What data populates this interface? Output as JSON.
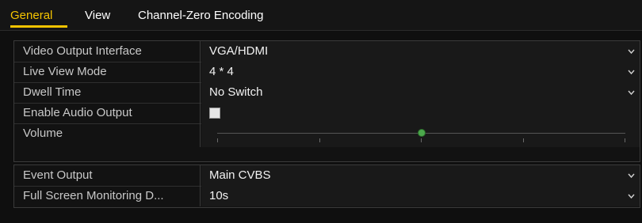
{
  "tabs": [
    {
      "label": "General",
      "active": true
    },
    {
      "label": "View",
      "active": false
    },
    {
      "label": "Channel-Zero Encoding",
      "active": false
    }
  ],
  "settings": {
    "video_output_interface": {
      "label": "Video Output Interface",
      "value": "VGA/HDMI"
    },
    "live_view_mode": {
      "label": "Live View Mode",
      "value": "4 * 4"
    },
    "dwell_time": {
      "label": "Dwell Time",
      "value": "No Switch"
    },
    "enable_audio_output": {
      "label": "Enable Audio Output",
      "checked": false
    },
    "volume": {
      "label": "Volume",
      "level": 0.5
    },
    "event_output": {
      "label": "Event Output",
      "value": "Main CVBS"
    },
    "full_screen_monitoring": {
      "label": "Full Screen Monitoring D...",
      "value": "10s"
    }
  },
  "colors": {
    "accent": "#f5c400",
    "slider_knob": "#4ca84c"
  },
  "icons": {
    "dropdown": "chevron-down-icon"
  }
}
